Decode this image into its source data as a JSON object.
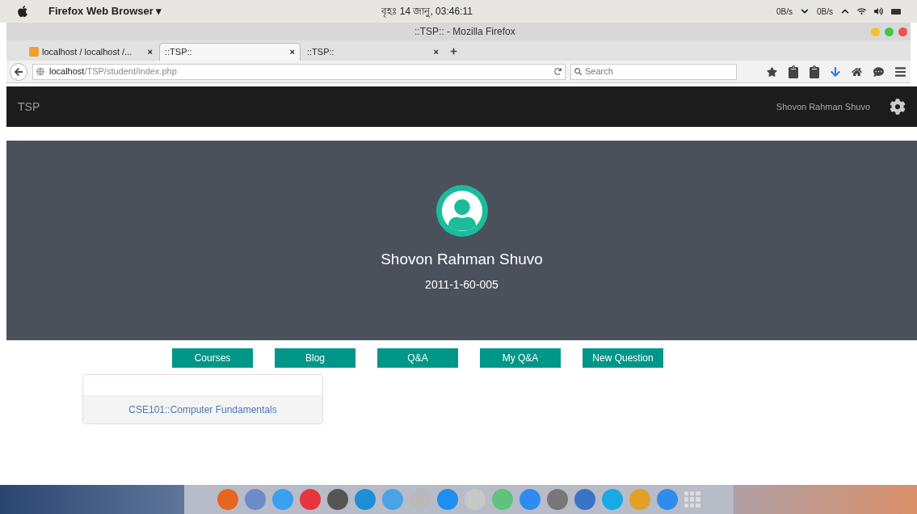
{
  "menu_bar": {
    "app": "Firefox Web Browser ▾",
    "clock": "বৃহঃ 14 জানু, 03:46:11",
    "net_down": "0B/s",
    "net_up": "0B/s"
  },
  "window": {
    "title": "::TSP:: - Mozilla Firefox"
  },
  "tabs": [
    {
      "label": "localhost / localhost /...",
      "selected": false,
      "close": "×"
    },
    {
      "label": "::TSP::",
      "selected": true,
      "close": "×"
    },
    {
      "label": "::TSP::",
      "selected": false,
      "close": "×"
    }
  ],
  "address_bar": {
    "host": "localhost",
    "path": "/TSP/student/index.php"
  },
  "search": {
    "placeholder": "Search"
  },
  "site_nav": {
    "brand": "TSP",
    "user": "Shovon Rahman Shuvo"
  },
  "profile": {
    "name": "Shovon Rahman Shuvo",
    "id": "2011-1-60-005"
  },
  "nav_buttons": [
    "Courses",
    "Blog",
    "Q&A",
    "My Q&A",
    "New Question"
  ],
  "courses": [
    {
      "title": "CSE101::Computer Fundamentals"
    }
  ],
  "dock": [
    {
      "color": "#e8651f"
    },
    {
      "color": "#6a8cc9"
    },
    {
      "color": "#3aa0f0"
    },
    {
      "color": "#e8343c"
    },
    {
      "color": "#555555"
    },
    {
      "color": "#1d8fd8"
    },
    {
      "color": "#4aa3e8"
    },
    {
      "color": "#b9b9b9"
    },
    {
      "color": "#1f8ef1"
    },
    {
      "color": "#c8c8c8"
    },
    {
      "color": "#5fc27e"
    },
    {
      "color": "#2d8cf0"
    },
    {
      "color": "#777777"
    },
    {
      "color": "#3b73c8"
    },
    {
      "color": "#19a9e5"
    },
    {
      "color": "#e2a125"
    },
    {
      "color": "#2d8cf0"
    }
  ]
}
